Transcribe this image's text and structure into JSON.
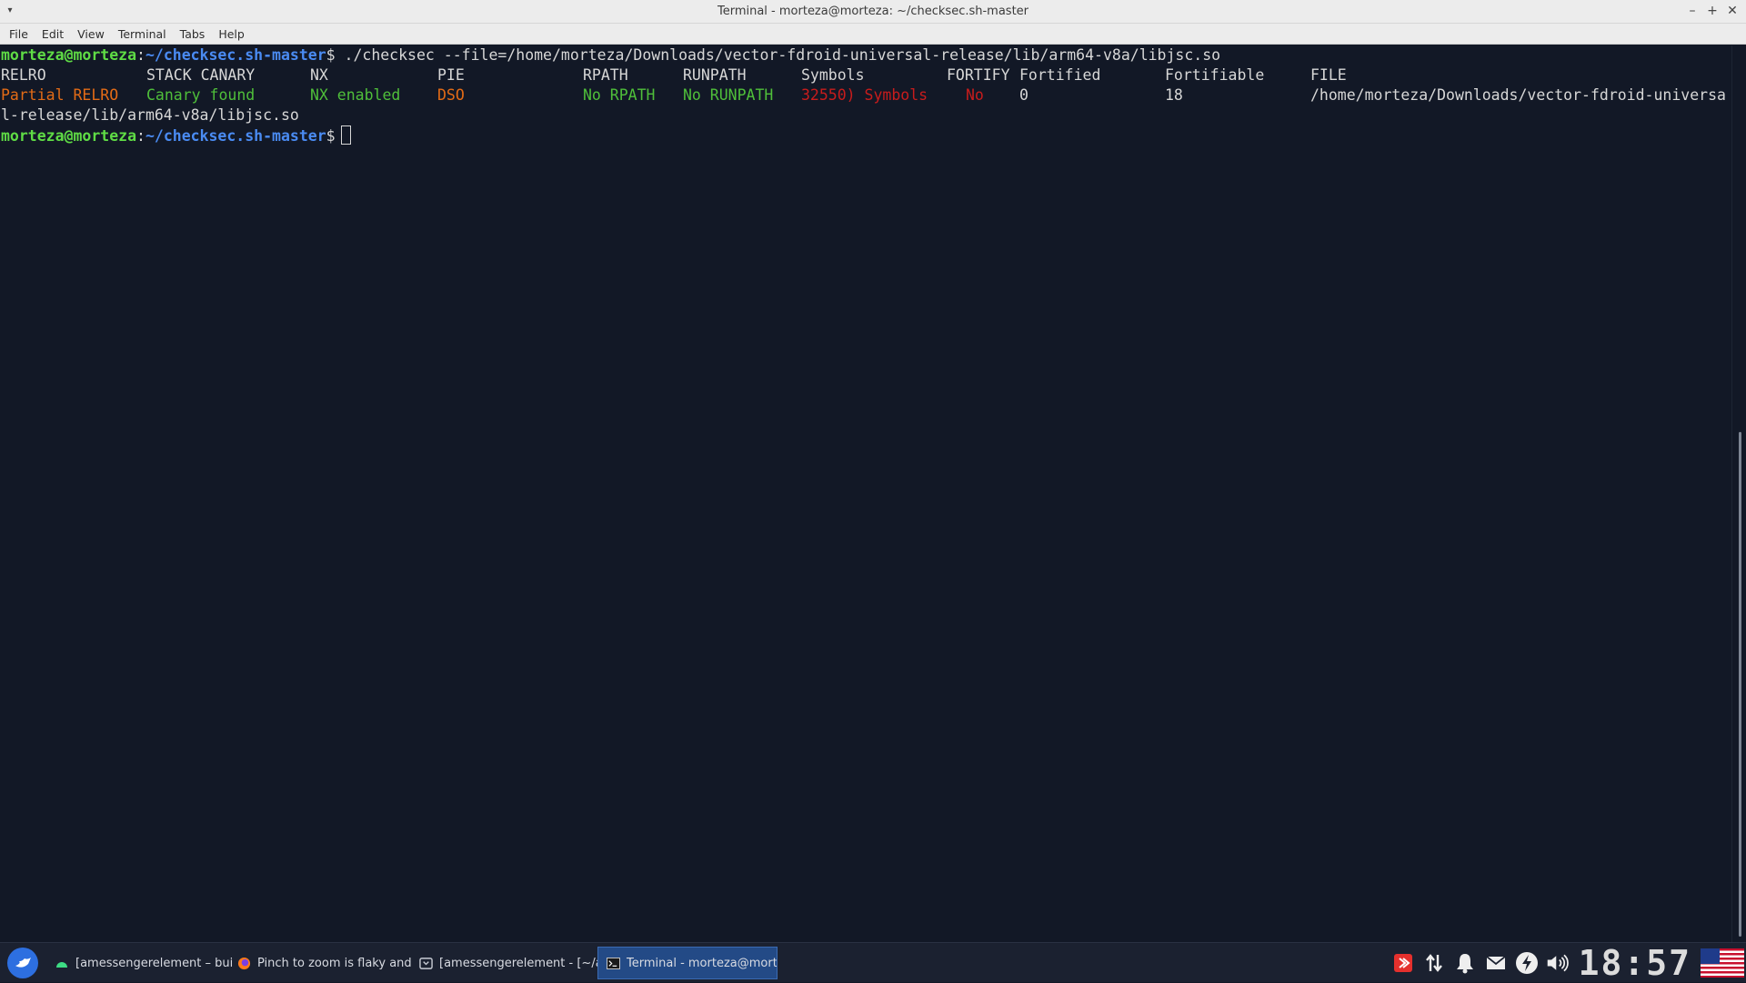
{
  "window": {
    "title": "Terminal - morteza@morteza: ~/checksec.sh-master"
  },
  "menu": {
    "items": [
      "File",
      "Edit",
      "View",
      "Terminal",
      "Tabs",
      "Help"
    ]
  },
  "terminal": {
    "prompt_user": "morteza@morteza",
    "prompt_sep": ":",
    "prompt_path": "~/checksec.sh-master",
    "prompt_dollar": "$",
    "command": " ./checksec --file=/home/morteza/Downloads/vector-fdroid-universal-release/lib/arm64-v8a/libjsc.so",
    "headers": {
      "relro": "RELRO",
      "canary": "STACK CANARY",
      "nx": "NX",
      "pie": "PIE",
      "rpath": "RPATH",
      "runpath": "RUNPATH",
      "symbols": "Symbols",
      "fortify": "FORTIFY",
      "fortified": "Fortified",
      "fortifiable": "Fortifiable",
      "file": "FILE"
    },
    "result": {
      "relro": "Partial RELRO",
      "canary": "Canary found",
      "nx": "NX enabled",
      "pie": "DSO",
      "rpath": "No RPATH",
      "runpath": "No RUNPATH",
      "symbols": "32550) Symbols",
      "fortify": "No",
      "fortified": "0",
      "fortifiable": "18",
      "file_part1": "/home/morteza/Downloads/vector-fdroid-universa",
      "file_part2": "l-release/lib/arm64-v8a/libjsc.so"
    }
  },
  "taskbar": {
    "tasks": [
      {
        "label": "[amessengerelement – build...",
        "icon": "android-icon"
      },
      {
        "label": "Pinch to zoom is flaky and ov...",
        "icon": "firefox-icon"
      },
      {
        "label": "[amessengerelement - [~/a...",
        "icon": "app-window-icon"
      },
      {
        "label": "Terminal - morteza@mortez...",
        "icon": "terminal-icon"
      }
    ],
    "clock": "18:57"
  },
  "colors": {
    "terminal_bg": "#121826",
    "prompt_green": "#5fdc45",
    "path_blue": "#4a8bf2",
    "warn_orange": "#e36b16",
    "ok_green": "#4fbf3a",
    "bad_red": "#c81c1c",
    "taskbar_bg": "#1b2130",
    "active_task": "#234a86"
  }
}
